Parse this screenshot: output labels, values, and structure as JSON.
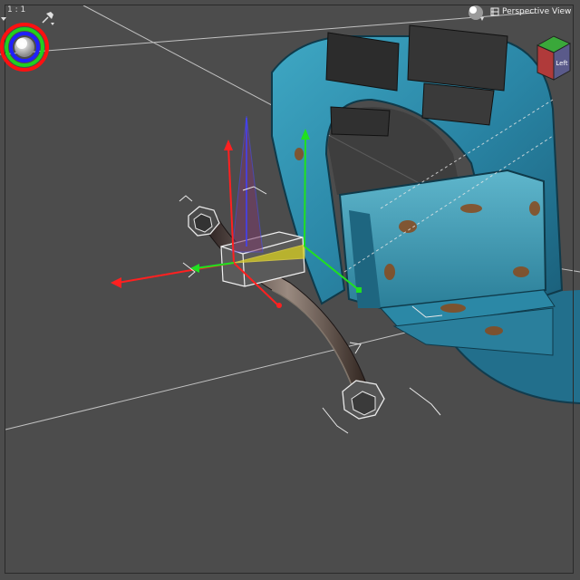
{
  "viewport": {
    "scale_label": "1 : 1",
    "view_name": "Perspective View",
    "viewcube_face": "Left"
  },
  "icons": {
    "light_sphere": "light-sphere-icon",
    "pin": "pin-icon",
    "gizmo": "orientation-gizmo-icon",
    "perspective": "perspective-view-icon",
    "viewcube": "viewcube-icon"
  },
  "colors": {
    "background": "#4c4c4c",
    "grid": "#d8d8d8",
    "axis_x": "#ff2020",
    "axis_y": "#20e020",
    "axis_z": "#3a3aff",
    "vise_body": "#2a8aa8",
    "selection": "#ffffff"
  }
}
